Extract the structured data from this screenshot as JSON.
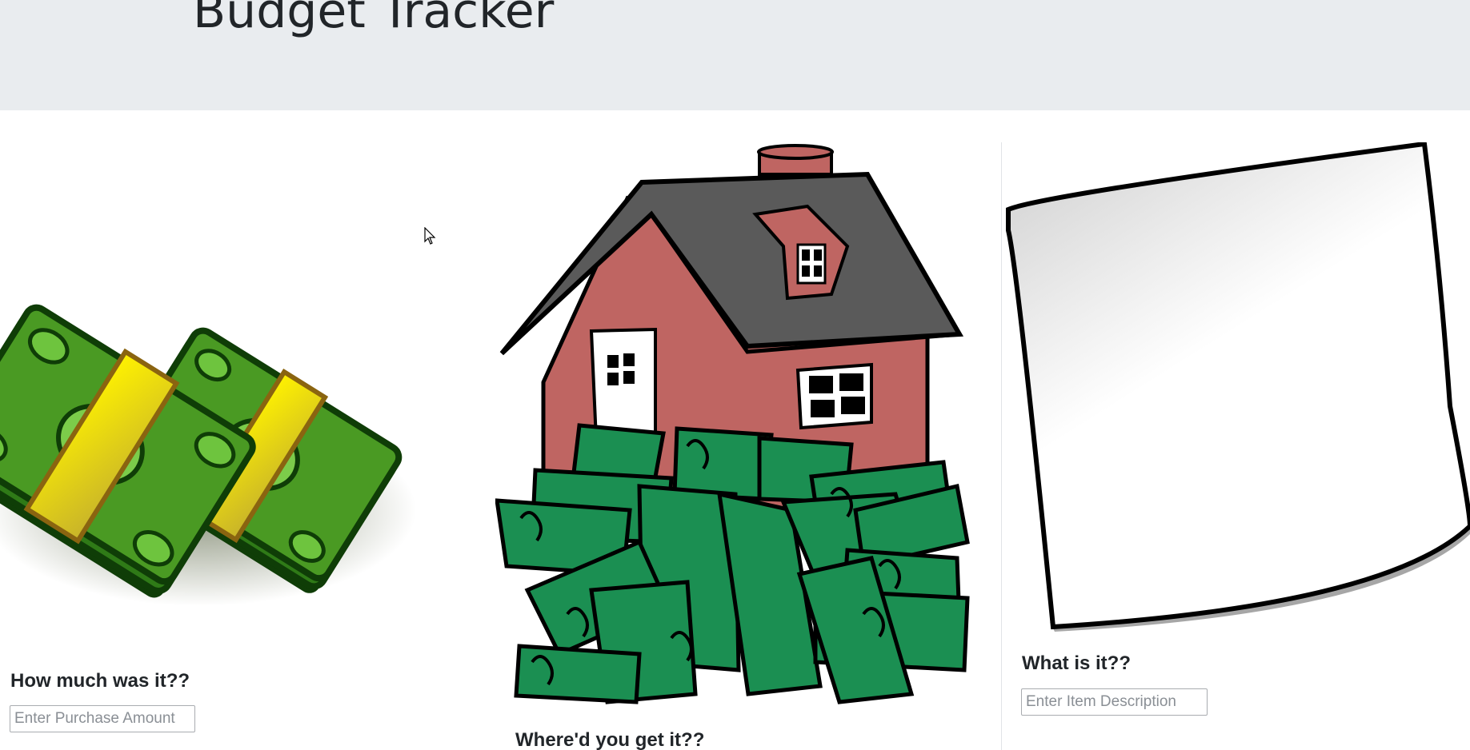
{
  "header": {
    "title": "Budget Tracker"
  },
  "cards": {
    "amount": {
      "label": "How much was it??",
      "placeholder": "Enter Purchase Amount"
    },
    "place": {
      "label": "Where'd you get it??"
    },
    "item": {
      "label": "What is it??",
      "placeholder": "Enter Item Description"
    }
  },
  "colors": {
    "header_bg": "#e9ecef",
    "money_green": "#4a9a23",
    "house_red": "#bf6562",
    "roof_gray": "#5a5a5a",
    "bill_green": "#1b8f52"
  },
  "icons": [
    "cash-stack-image",
    "house-on-money-image",
    "blank-note-image",
    "mouse-cursor-icon"
  ]
}
